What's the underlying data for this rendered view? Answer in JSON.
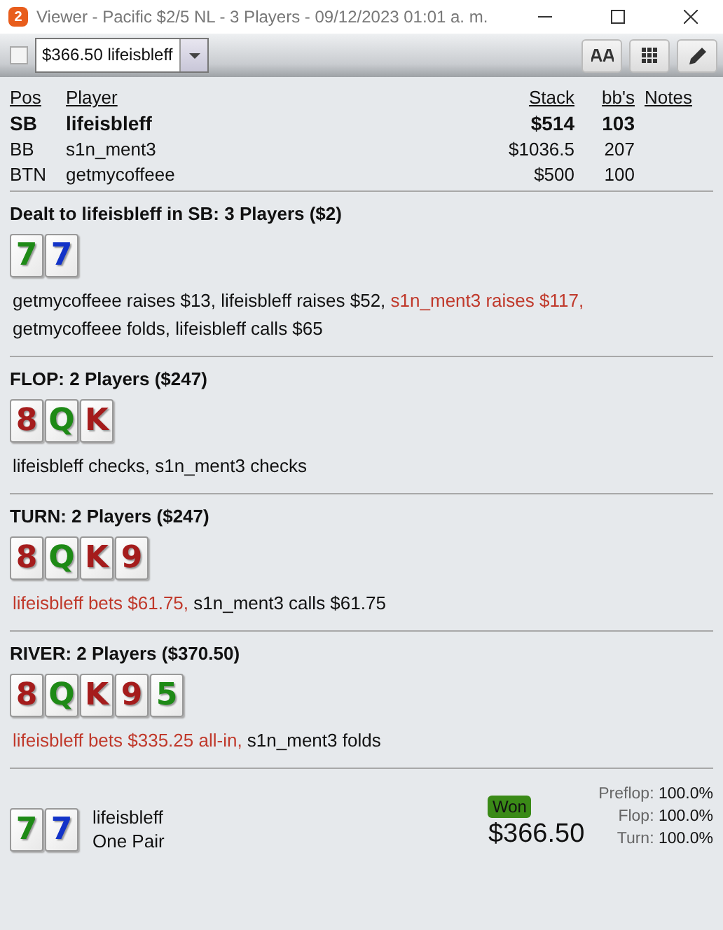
{
  "window": {
    "title": "Viewer - Pacific $2/5 NL - 3 Players - 09/12/2023 01:01 a. m.",
    "badge": "2"
  },
  "toolbar": {
    "checkbox": {
      "checked": false
    },
    "hand_select": {
      "value": "$366.50 lifeisbleff"
    }
  },
  "players": {
    "columns": [
      "Pos",
      "Player",
      "Stack",
      "bb's",
      "Notes"
    ],
    "rows": [
      {
        "pos": "SB",
        "player": "lifeisbleff",
        "stack": "$514",
        "bbs": "103",
        "hero": true
      },
      {
        "pos": "BB",
        "player": "s1n_ment3",
        "stack": "$1036.5",
        "bbs": "207",
        "hero": false
      },
      {
        "pos": "BTN",
        "player": "getmycoffeee",
        "stack": "$500",
        "bbs": "100",
        "hero": false
      }
    ]
  },
  "streets": [
    {
      "heading": "Dealt to lifeisbleff in SB: 3 Players ($2)",
      "cards": [
        {
          "rank": "7",
          "color": "#1e8a16"
        },
        {
          "rank": "7",
          "color": "#1233c8"
        }
      ],
      "actions": [
        {
          "text": "getmycoffeee raises $13, lifeisbleff raises $52, ",
          "aggressive": false
        },
        {
          "text": "s1n_ment3 raises $117,",
          "aggressive": true
        },
        {
          "text": " getmycoffeee folds, lifeisbleff calls $65",
          "aggressive": false
        }
      ]
    },
    {
      "heading": "FLOP: 2 Players ($247)",
      "cards": [
        {
          "rank": "8",
          "color": "#a51c1c"
        },
        {
          "rank": "Q",
          "color": "#1e8a16"
        },
        {
          "rank": "K",
          "color": "#a51c1c"
        }
      ],
      "actions": [
        {
          "text": "lifeisbleff checks, s1n_ment3 checks",
          "aggressive": false
        }
      ]
    },
    {
      "heading": "TURN: 2 Players ($247)",
      "cards": [
        {
          "rank": "8",
          "color": "#a51c1c"
        },
        {
          "rank": "Q",
          "color": "#1e8a16"
        },
        {
          "rank": "K",
          "color": "#a51c1c"
        },
        {
          "rank": "9",
          "color": "#a51c1c"
        }
      ],
      "actions": [
        {
          "text": "lifeisbleff bets $61.75,",
          "aggressive": true
        },
        {
          "text": " s1n_ment3 calls $61.75",
          "aggressive": false
        }
      ]
    },
    {
      "heading": "RIVER: 2 Players ($370.50)",
      "cards": [
        {
          "rank": "8",
          "color": "#a51c1c"
        },
        {
          "rank": "Q",
          "color": "#1e8a16"
        },
        {
          "rank": "K",
          "color": "#a51c1c"
        },
        {
          "rank": "9",
          "color": "#a51c1c"
        },
        {
          "rank": "5",
          "color": "#1e8a16"
        }
      ],
      "actions": [
        {
          "text": "lifeisbleff bets $335.25 all-in,",
          "aggressive": true
        },
        {
          "text": " s1n_ment3 folds",
          "aggressive": false
        }
      ]
    }
  ],
  "result": {
    "cards": [
      {
        "rank": "7",
        "color": "#1e8a16"
      },
      {
        "rank": "7",
        "color": "#1233c8"
      }
    ],
    "player": "lifeisbleff",
    "hand": "One Pair",
    "outcome": "Won",
    "amount": "$366.50",
    "equity": [
      {
        "label": "Preflop:",
        "value": "100.0%"
      },
      {
        "label": "Flop:",
        "value": "100.0%"
      },
      {
        "label": "Turn:",
        "value": "100.0%"
      }
    ]
  }
}
